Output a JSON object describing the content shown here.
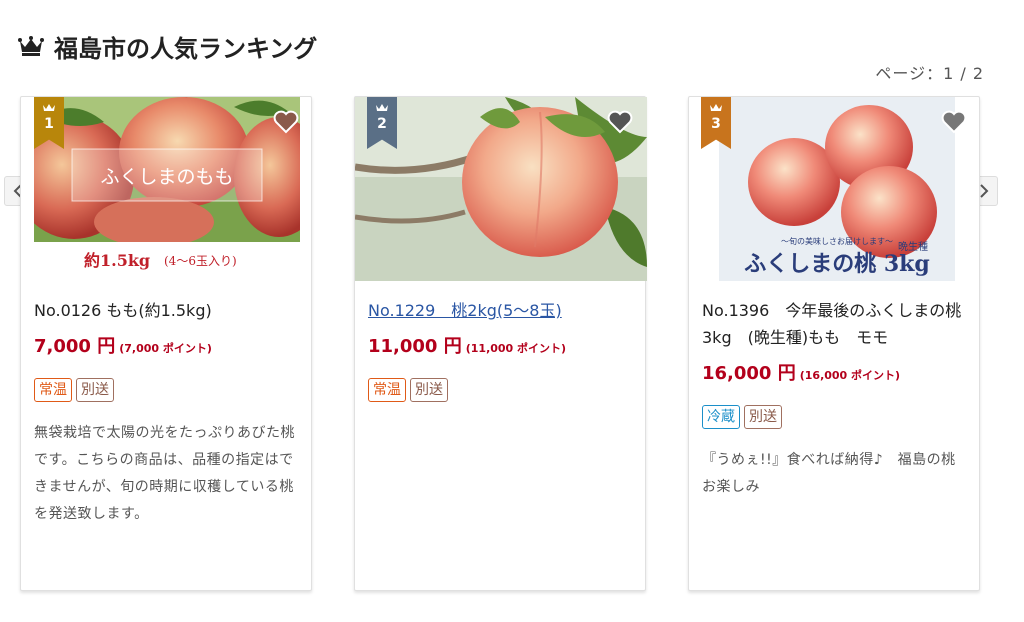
{
  "header": {
    "title": "福島市の人気ランキング",
    "page_indicator": "ページ：1 / 2"
  },
  "colors": {
    "price": "#b3001b",
    "rank1": "#b8860b",
    "rank2": "#5a6f86",
    "rank3": "#c8741d"
  },
  "products": [
    {
      "rank": "1",
      "image_text": "ふくしまのもも",
      "image_caption": "約1.5kg",
      "image_caption_sub": "(4～6玉入り)",
      "name": "No.0126 もも(約1.5kg)",
      "price": "7,000 円",
      "points": "(7,000 ポイント)",
      "tags": [
        "常温",
        "別送"
      ],
      "description": "無袋栽培で太陽の光をたっぷりあびた桃です。こちらの商品は、品種の指定はできませんが、旬の時期に収穫している桃を発送致します。"
    },
    {
      "rank": "2",
      "name": "No.1229　桃2kg(5～8玉)",
      "price": "11,000 円",
      "points": "(11,000 ポイント)",
      "tags": [
        "常温",
        "別送"
      ],
      "description": ""
    },
    {
      "rank": "3",
      "image_small_text": "～旬の美味しさお届けします～",
      "image_tag": "晩生種",
      "image_big_text": "ふくしまの桃 3kg",
      "name": "No.1396　今年最後のふくしまの桃　3kg　(晩生種)もも　モモ",
      "price": "16,000 円",
      "points": "(16,000 ポイント)",
      "tags": [
        "冷蔵",
        "別送"
      ],
      "description": "『うめぇ!!』食べれば納得♪　福島の桃　お楽しみ"
    }
  ]
}
